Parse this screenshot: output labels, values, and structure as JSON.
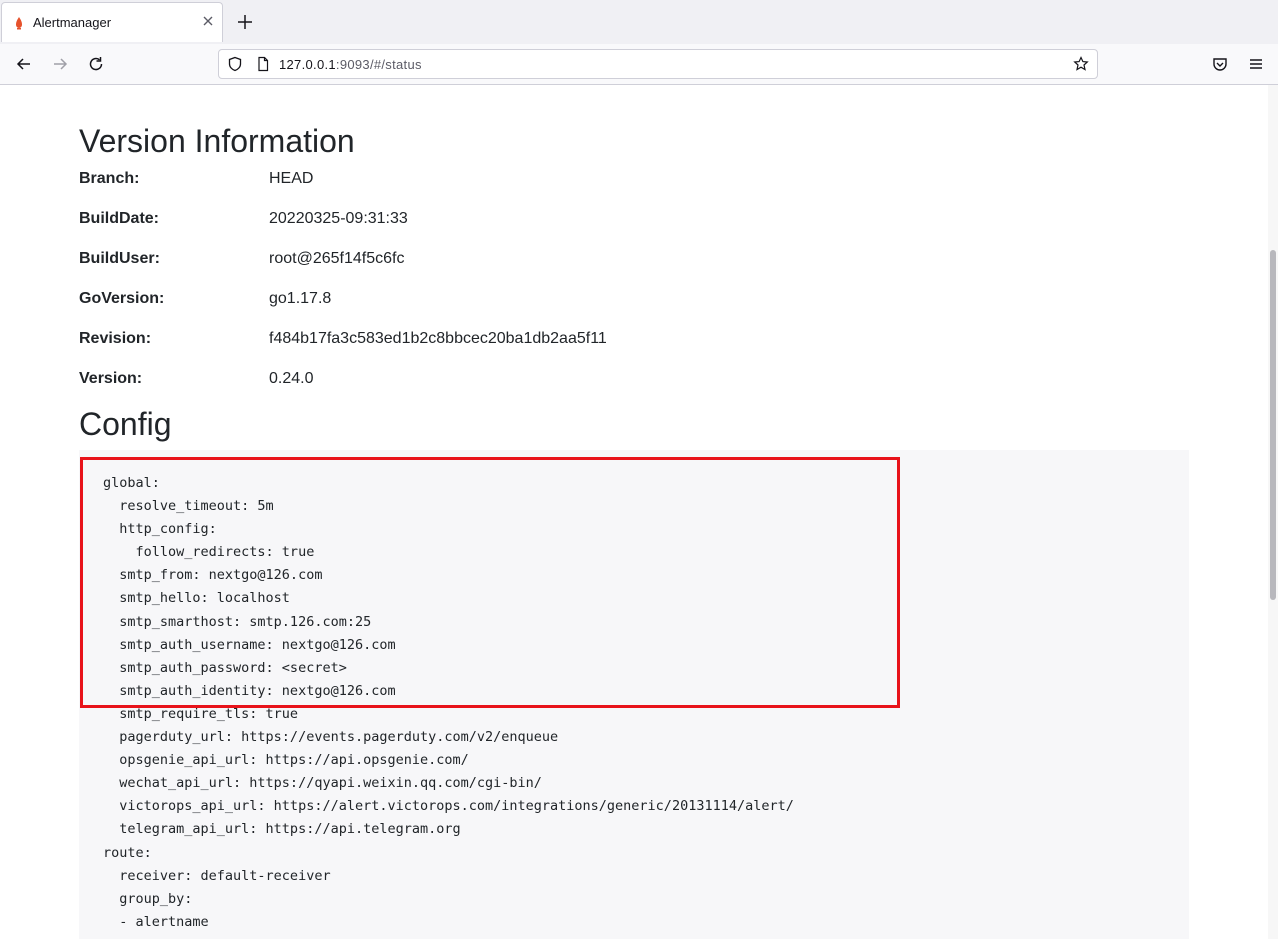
{
  "browser": {
    "tab_title": "Alertmanager",
    "url_host": "127.0.0.1",
    "url_rest": ":9093/#/status"
  },
  "version": {
    "heading": "Version Information",
    "rows": [
      {
        "key": "Branch:",
        "value": "HEAD"
      },
      {
        "key": "BuildDate:",
        "value": "20220325-09:31:33"
      },
      {
        "key": "BuildUser:",
        "value": "root@265f14f5c6fc"
      },
      {
        "key": "GoVersion:",
        "value": "go1.17.8"
      },
      {
        "key": "Revision:",
        "value": "f484b17fa3c583ed1b2c8bbcec20ba1db2aa5f11"
      },
      {
        "key": "Version:",
        "value": "0.24.0"
      }
    ]
  },
  "config": {
    "heading": "Config",
    "lines": [
      "global:",
      "  resolve_timeout: 5m",
      "  http_config:",
      "    follow_redirects: true",
      "  smtp_from: nextgo@126.com",
      "  smtp_hello: localhost",
      "  smtp_smarthost: smtp.126.com:25",
      "  smtp_auth_username: nextgo@126.com",
      "  smtp_auth_password: <secret>",
      "  smtp_auth_identity: nextgo@126.com",
      "  smtp_require_tls: true",
      "  pagerduty_url: https://events.pagerduty.com/v2/enqueue",
      "  opsgenie_api_url: https://api.opsgenie.com/",
      "  wechat_api_url: https://qyapi.weixin.qq.com/cgi-bin/",
      "  victorops_api_url: https://alert.victorops.com/integrations/generic/20131114/alert/",
      "  telegram_api_url: https://api.telegram.org",
      "route:",
      "  receiver: default-receiver",
      "  group_by:",
      "  - alertname"
    ]
  },
  "colors": {
    "highlight": "#e8131a",
    "config_bg": "#f7f7f9"
  }
}
